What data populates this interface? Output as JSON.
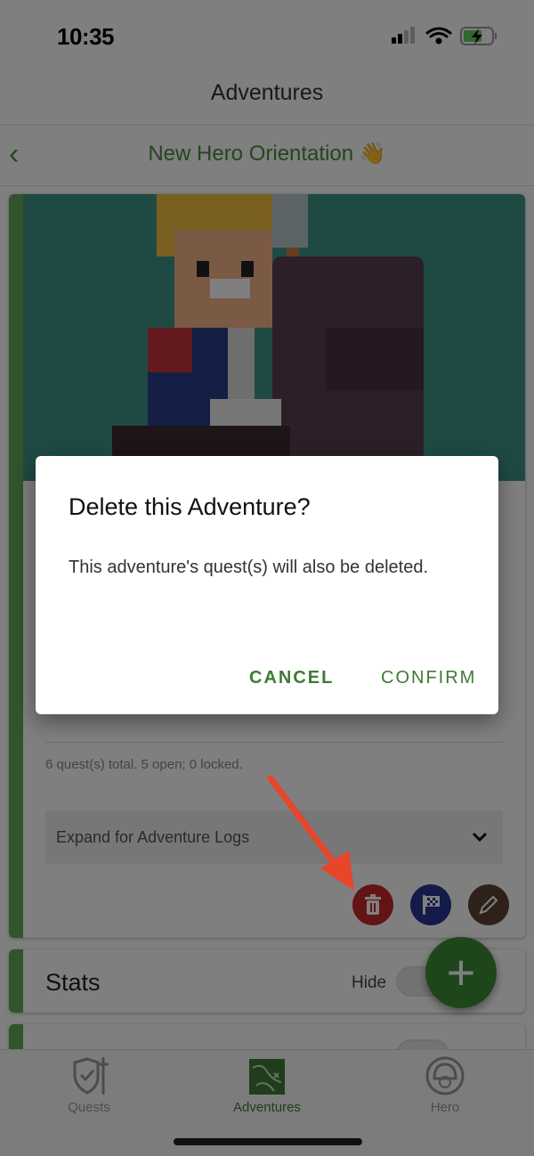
{
  "status_bar": {
    "time": "10:35",
    "icons": [
      "cellular-signal-icon",
      "wifi-icon",
      "battery-charging-icon"
    ]
  },
  "nav": {
    "title": "Adventures"
  },
  "subheader": {
    "title": "New Hero Orientation 👋",
    "back_icon": "chevron-left-icon"
  },
  "adventure_card": {
    "quest_summary": "6 quest(s) total. 5 open; 0 locked.",
    "expand_label": "Expand for Adventure Logs",
    "actions": [
      {
        "name": "delete",
        "icon": "trash-icon",
        "color": "#c62828"
      },
      {
        "name": "complete",
        "icon": "checkered-flag-icon",
        "color": "#283593"
      },
      {
        "name": "edit",
        "icon": "pencil-icon",
        "color": "#5d4037"
      }
    ]
  },
  "stats_card": {
    "title": "Stats",
    "toggle_label": "Hide",
    "toggle_on": false
  },
  "fab": {
    "label": "+"
  },
  "tabs": [
    {
      "label": "Quests",
      "active": false
    },
    {
      "label": "Adventures",
      "active": true
    },
    {
      "label": "Hero",
      "active": false
    }
  ],
  "dialog": {
    "title": "Delete this Adventure?",
    "body": "This adventure's quest(s) will also be deleted.",
    "cancel": "CANCEL",
    "confirm": "CONFIRM"
  },
  "colors": {
    "accent": "#4a8a3c",
    "annotation_arrow": "#e8452a"
  }
}
